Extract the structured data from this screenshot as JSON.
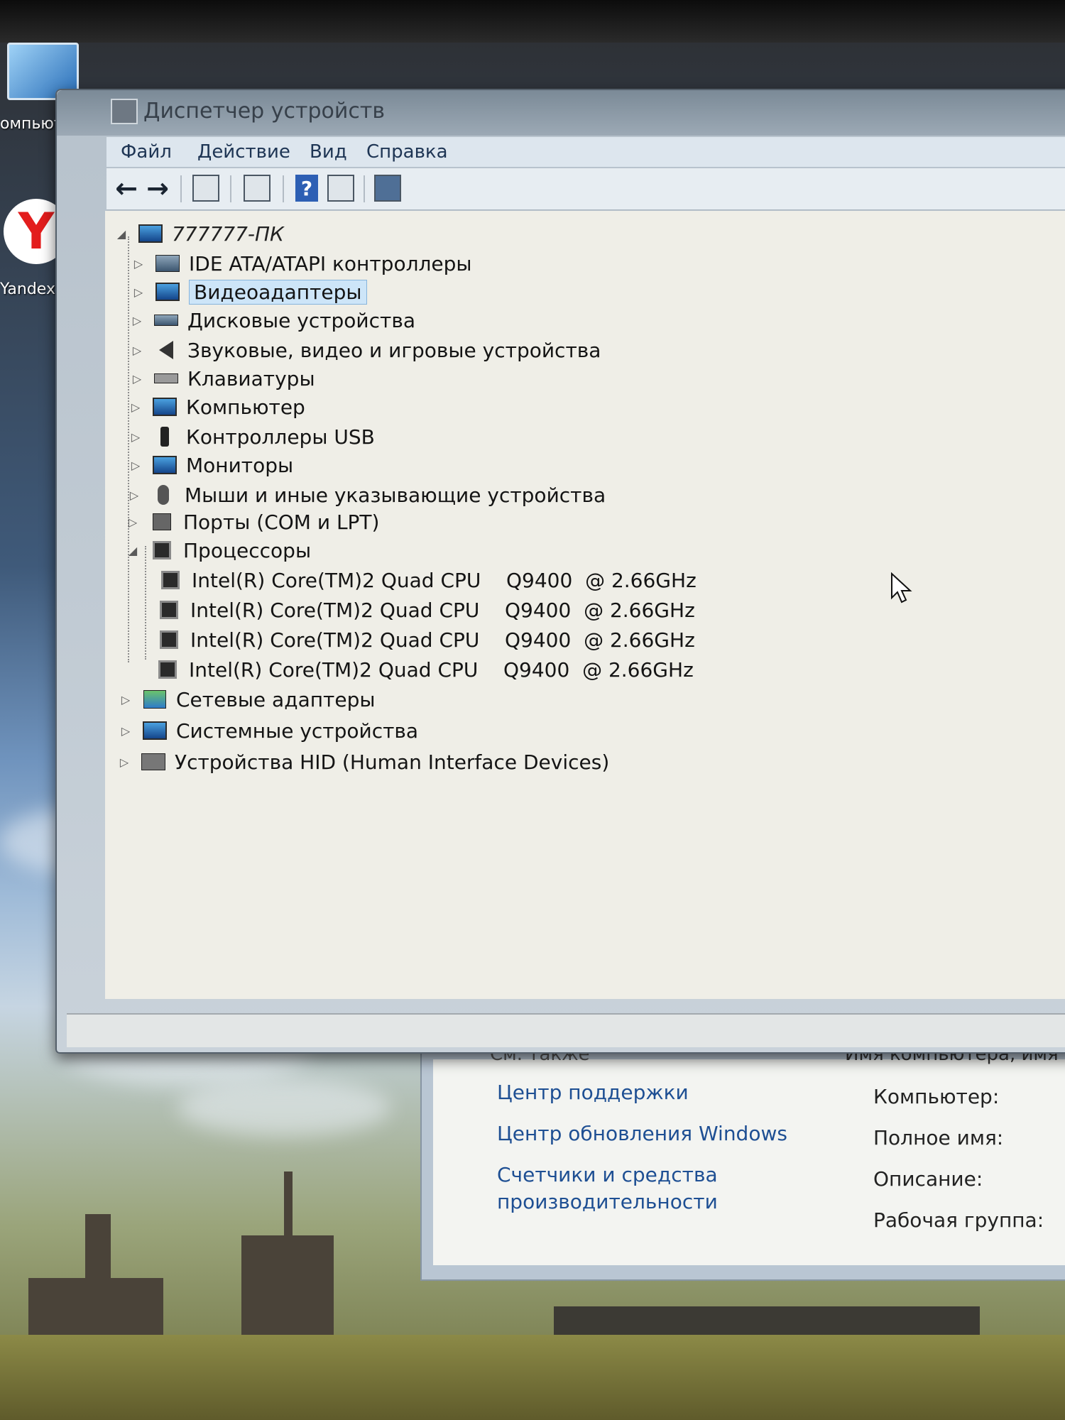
{
  "desktop": {
    "icons": [
      {
        "label": "омпьютер",
        "icon": "computer-icon"
      },
      {
        "label": "Yandex",
        "icon": "yandex-browser-icon"
      }
    ]
  },
  "device_manager": {
    "title": "Диспетчер устройств",
    "menu": [
      "Файл",
      "Действие",
      "Вид",
      "Справка"
    ],
    "toolbar": [
      "back-icon",
      "forward-icon",
      "show-hide-tree-icon",
      "properties-icon",
      "help-icon",
      "view-icon",
      "scan-hardware-icon"
    ],
    "root": "777777-ПК",
    "categories": [
      {
        "label": "IDE ATA/ATAPI контроллеры",
        "icon": "ide-controller-icon",
        "expanded": false,
        "selected": false
      },
      {
        "label": "Видеоадаптеры",
        "icon": "display-adapter-icon",
        "expanded": false,
        "selected": true
      },
      {
        "label": "Дисковые устройства",
        "icon": "disk-drive-icon",
        "expanded": false,
        "selected": false
      },
      {
        "label": "Звуковые, видео и игровые устройства",
        "icon": "speaker-icon",
        "expanded": false,
        "selected": false
      },
      {
        "label": "Клавиатуры",
        "icon": "keyboard-icon",
        "expanded": false,
        "selected": false
      },
      {
        "label": "Компьютер",
        "icon": "computer-icon",
        "expanded": false,
        "selected": false
      },
      {
        "label": "Контроллеры USB",
        "icon": "usb-icon",
        "expanded": false,
        "selected": false
      },
      {
        "label": "Мониторы",
        "icon": "monitor-icon",
        "expanded": false,
        "selected": false
      },
      {
        "label": "Мыши и иные указывающие устройства",
        "icon": "mouse-icon",
        "expanded": false,
        "selected": false
      },
      {
        "label": "Порты (COM и LPT)",
        "icon": "port-icon",
        "expanded": false,
        "selected": false
      },
      {
        "label": "Процессоры",
        "icon": "processor-icon",
        "expanded": true,
        "selected": false
      },
      {
        "label": "Сетевые адаптеры",
        "icon": "network-adapter-icon",
        "expanded": false,
        "selected": false
      },
      {
        "label": "Системные устройства",
        "icon": "system-device-icon",
        "expanded": false,
        "selected": false
      },
      {
        "label": "Устройства HID (Human Interface Devices)",
        "icon": "hid-icon",
        "expanded": false,
        "selected": false
      }
    ],
    "processors": [
      "Intel(R) Core(TM)2 Quad CPU    Q9400  @ 2.66GHz",
      "Intel(R) Core(TM)2 Quad CPU    Q9400  @ 2.66GHz",
      "Intel(R) Core(TM)2 Quad CPU    Q9400  @ 2.66GHz",
      "Intel(R) Core(TM)2 Quad CPU    Q9400  @ 2.66GHz"
    ]
  },
  "system_window": {
    "see_also": "См. также",
    "links": [
      "Центр поддержки",
      "Центр обновления Windows",
      "Счетчики и средства",
      "производительности"
    ],
    "heading": "Имя компьютера, имя до",
    "labels": [
      "Компьютер:",
      "Полное имя:",
      "Описание:",
      "Рабочая группа:"
    ]
  },
  "colors": {
    "selection": "#cde5f8",
    "link": "#1e4f93",
    "tree_background": "#efeee7"
  }
}
